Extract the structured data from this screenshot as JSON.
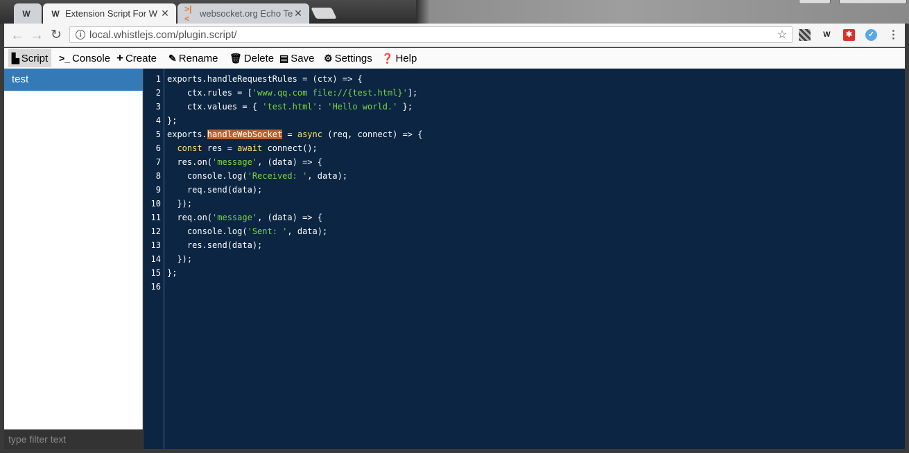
{
  "tabs": [
    {
      "title": "",
      "icon": "whistle-logo-icon",
      "active": false
    },
    {
      "title": "Extension Script For W",
      "icon": "whistle-logo-icon",
      "active": true
    },
    {
      "title": "websocket.org Echo Te",
      "icon": "websocket-logo-icon",
      "active": false
    }
  ],
  "address_bar": {
    "url": "local.whistlejs.com/plugin.script/"
  },
  "colors": {
    "sidebar_active": "#337ab7",
    "editor_bg": "#0b2543",
    "string": "#7fd440",
    "highlight": "#b9602b"
  },
  "menu": {
    "script": "Script",
    "console": "Console",
    "create": "Create",
    "rename": "Rename",
    "delete": "Delete",
    "save": "Save",
    "settings": "Settings",
    "help": "Help"
  },
  "sidebar": {
    "items": [
      "test"
    ],
    "filter_placeholder": "type filter text"
  },
  "editor": {
    "line_numbers": [
      "1",
      "2",
      "3",
      "4",
      "5",
      "6",
      "7",
      "8",
      "9",
      "10",
      "11",
      "12",
      "13",
      "14",
      "15",
      "16"
    ],
    "lines": [
      "exports.handleRequestRules = (ctx) => {",
      "    ctx.rules = ['www.qq.com file://{test.html}'];",
      "    ctx.values = { 'test.html': 'Hello world.' };",
      "};",
      "exports.handleWebSocket = async (req, connect) => {",
      "  const res = await connect();",
      "  res.on('message', (data) => {",
      "    console.log('Received: ', data);",
      "    req.send(data);",
      "  });",
      "  req.on('message', (data) => {",
      "    console.log('Sent: ', data);",
      "    res.send(data);",
      "  });",
      "};",
      ""
    ]
  }
}
